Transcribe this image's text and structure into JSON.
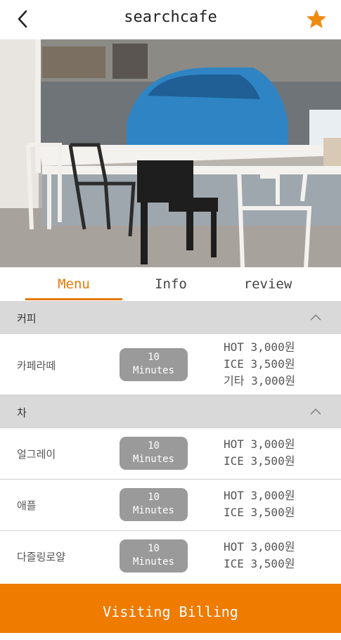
{
  "header": {
    "title": "searchcafe",
    "back_icon": "back-arrow-icon",
    "favorite_icon": "star-icon",
    "accent": "#f08a10"
  },
  "hero": {
    "slide_count": 3,
    "active_slide": 1
  },
  "tabs": [
    {
      "label": "Menu",
      "active": true
    },
    {
      "label": "Info",
      "active": false
    },
    {
      "label": "review",
      "active": false
    }
  ],
  "menu": {
    "categories": [
      {
        "name": "커피",
        "items": [
          {
            "name": "카페라떼",
            "time_value": "10",
            "time_unit": "Minutes",
            "prices": [
              "HOT 3,000원",
              "ICE 3,500원",
              "기타 3,000원"
            ]
          }
        ]
      },
      {
        "name": "차",
        "items": [
          {
            "name": "얼그레이",
            "time_value": "10",
            "time_unit": "Minutes",
            "prices": [
              "HOT 3,000원",
              "ICE 3,500원"
            ]
          },
          {
            "name": "애플",
            "time_value": "10",
            "time_unit": "Minutes",
            "prices": [
              "HOT 3,000원",
              "ICE 3,500원"
            ]
          },
          {
            "name": "다즐링로얄",
            "time_value": "10",
            "time_unit": "Minutes",
            "prices": [
              "HOT 3,000원",
              "ICE 3,500원"
            ]
          }
        ]
      }
    ]
  },
  "footer": {
    "button_label": "Visiting Billing",
    "color": "#ef7b00"
  }
}
